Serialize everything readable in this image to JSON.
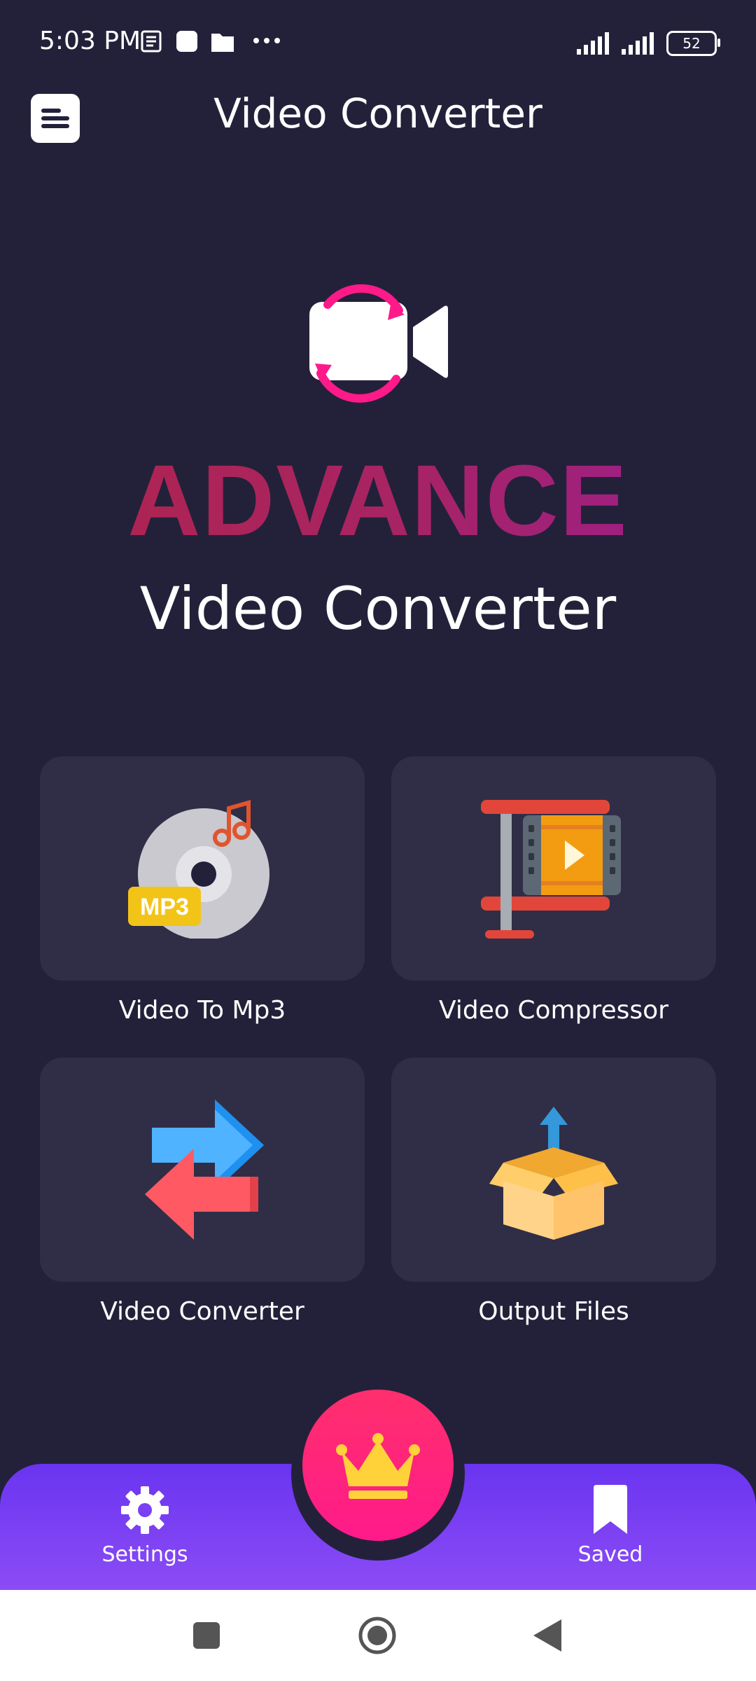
{
  "status_bar": {
    "time": "5:03 PM",
    "battery": "52",
    "icons": [
      "news-icon",
      "square-notification-icon",
      "folder-icon",
      "more-dots-icon",
      "signal-icon",
      "signal-icon"
    ]
  },
  "app_bar": {
    "title": "Video Converter",
    "menu_icon": "menu-list-icon"
  },
  "hero": {
    "headline": "ADVANCE",
    "subtitle": "Video Converter",
    "logo_icon": "video-camera-sync-icon"
  },
  "features": [
    {
      "label": "Video To Mp3",
      "icon": "mp3-disc-icon"
    },
    {
      "label": "Video Compressor",
      "icon": "film-press-icon"
    },
    {
      "label": "Video Converter",
      "icon": "swap-arrows-icon"
    },
    {
      "label": "Output Files",
      "icon": "open-box-upload-icon"
    }
  ],
  "bottom_nav": {
    "settings_label": "Settings",
    "saved_label": "Saved",
    "premium_icon": "crown-icon"
  },
  "colors": {
    "background": "#23213a",
    "card": "#302e46",
    "accent_pink": "#ff1a7a",
    "nav_purple": "#6a34f0",
    "advance_gradient_start": "#b0244c",
    "advance_gradient_end": "#9a1e8e"
  }
}
